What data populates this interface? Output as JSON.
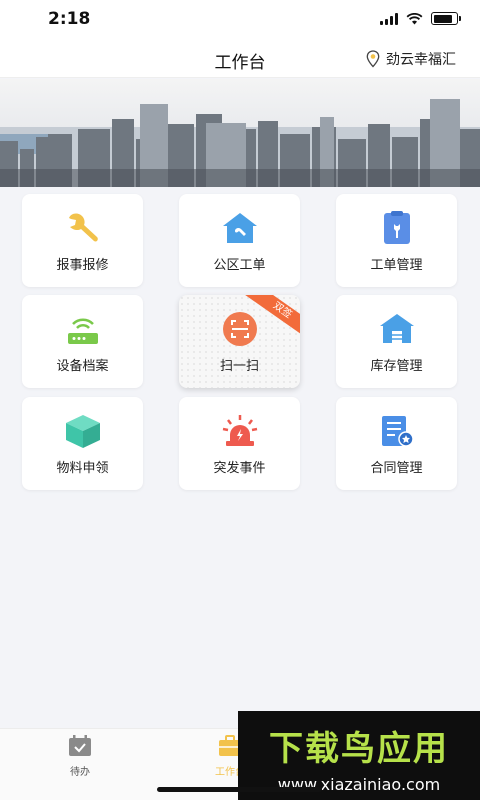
{
  "status_bar": {
    "time": "2:18",
    "battery_level": 0.85
  },
  "nav": {
    "title": "工作台",
    "location": "劲云幸福汇"
  },
  "tiles": [
    {
      "label": "报事报修",
      "icon": "wrench-icon",
      "color": "#f2c24b"
    },
    {
      "label": "公区工单",
      "icon": "house-wrench-icon",
      "color": "#4aa0e6"
    },
    {
      "label": "工单管理",
      "icon": "clipboard-wrench-icon",
      "color": "#5a8ee6"
    },
    {
      "label": "设备档案",
      "icon": "router-icon",
      "color": "#7ac94a"
    },
    {
      "label": "扫一扫",
      "icon": "scan-icon",
      "color": "#f07a4f",
      "badge": "双签"
    },
    {
      "label": "库存管理",
      "icon": "warehouse-icon",
      "color": "#4aa0e6"
    },
    {
      "label": "物料申领",
      "icon": "box-icon",
      "color": "#3fc5a8"
    },
    {
      "label": "突发事件",
      "icon": "siren-icon",
      "color": "#ee5a4f"
    },
    {
      "label": "合同管理",
      "icon": "contract-icon",
      "color": "#4a8ee6"
    }
  ],
  "tab_bar": {
    "tabs": [
      {
        "label": "待办",
        "icon": "calendar-check-icon"
      },
      {
        "label": "工作台",
        "icon": "briefcase-icon",
        "active": true
      }
    ]
  },
  "watermark": {
    "title": "下载鸟应用",
    "url": "www.xiazainiao.com"
  }
}
